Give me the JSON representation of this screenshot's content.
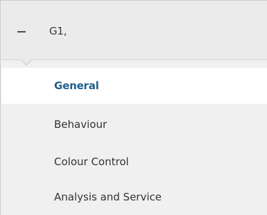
{
  "group": {
    "title": "G1,",
    "collapse_icon": "minus-icon"
  },
  "menu": {
    "items": [
      {
        "label": "General",
        "active": true
      },
      {
        "label": "Behaviour",
        "active": false
      },
      {
        "label": "Colour Control",
        "active": false
      },
      {
        "label": "Analysis and Service",
        "active": false
      }
    ]
  },
  "colors": {
    "panel_background": "#f0f0f0",
    "header_background": "#ebebeb",
    "active_item_background": "#ffffff",
    "active_item_text": "#1f5f8f",
    "item_text": "#333333"
  }
}
